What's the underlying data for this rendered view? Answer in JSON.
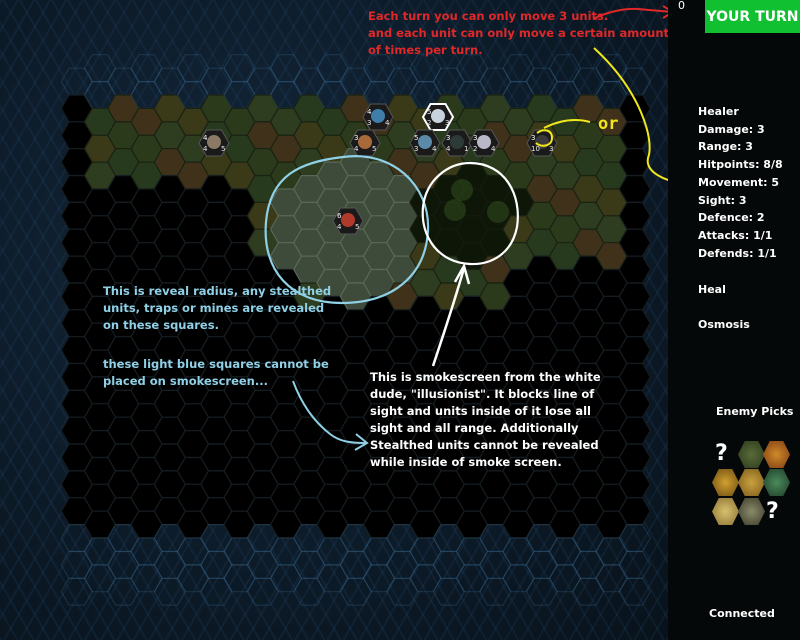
{
  "annotations": {
    "red_note": "Each turn you can only move 3 units.\nand each unit can only move a certain amount\nof times per turn.",
    "blue_note_1": "This is reveal radius, any stealthed\nunits, traps or mines are revealed\non these squares.",
    "blue_note_2": "these light blue squares cannot be\nplaced on smokescreen...",
    "white_note": "This is smokescreen from the white\ndude, \"illusionist\". It blocks line of\nsight and units inside of it lose all\nsight and all range. Additionally\nStealthed units cannot be revealed\nwhile inside of smoke screen.",
    "or_label": "or"
  },
  "header": {
    "turn_count": "0",
    "turn_button": "YOUR TURN"
  },
  "unit_info": {
    "name": "Healer",
    "damage": "Damage: 3",
    "range": "Range: 3",
    "hitpoints": "Hitpoints: 8/8",
    "movement": "Movement: 5",
    "sight": "Sight: 3",
    "defence": "Defence: 2",
    "attacks": "Attacks: 1/1",
    "defends": "Defends: 1/1"
  },
  "abilities": [
    "Heal",
    "Osmosis"
  ],
  "enemy_picks": {
    "title": "Enemy Picks",
    "unknown_mark": "?"
  },
  "status": {
    "connection": "Connected"
  },
  "colors": {
    "turn_button": "#10c030",
    "red_annotation": "#e02828",
    "blue_annotation": "#8fd0e6",
    "yellow_annotation": "#f0e61c",
    "panel_bg": "#050808"
  },
  "units": [
    {
      "name": "dark-knight",
      "stats": [
        "4",
        "4",
        "5"
      ],
      "color": "#8a7a66"
    },
    {
      "name": "blue-cloaked-unit",
      "stats": [
        "4",
        "3",
        "4"
      ],
      "color": "#3f7ea8"
    },
    {
      "name": "white-illusionist",
      "stats": [
        "5",
        "2",
        "3"
      ],
      "color": "#c8d2dc"
    },
    {
      "name": "brown-warrior",
      "stats": [
        "3",
        "4",
        "5"
      ],
      "color": "#a86a3a"
    },
    {
      "name": "blue-mage",
      "stats": [
        "5",
        "3",
        "4"
      ],
      "color": "#5a8aa8"
    },
    {
      "name": "dark-spearman",
      "stats": [
        "3",
        "4",
        "1"
      ],
      "color": "#2e3a38"
    },
    {
      "name": "silver-knight",
      "stats": [
        "3",
        "2",
        "4"
      ],
      "color": "#b8b8c8"
    },
    {
      "name": "healer",
      "stats": [
        "3",
        "10",
        "3"
      ],
      "color": "#3a3a3a"
    },
    {
      "name": "red-demon",
      "stats": [
        "6",
        "4",
        "5"
      ],
      "color": "#b03a2a"
    }
  ]
}
